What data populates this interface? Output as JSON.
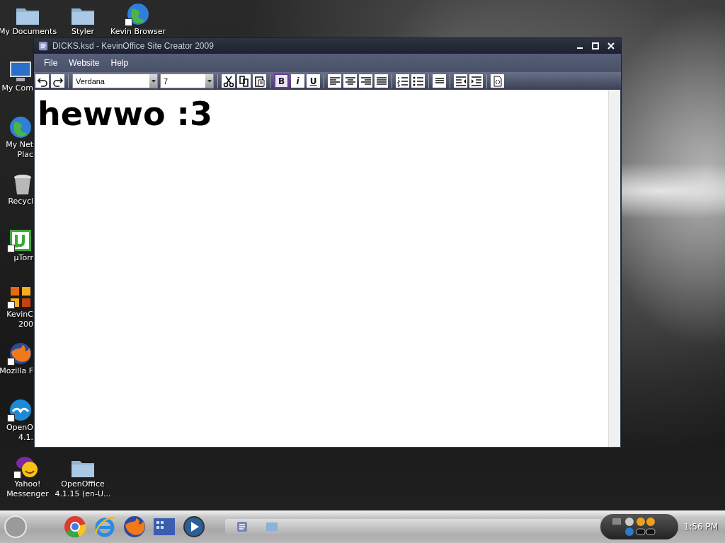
{
  "desktop_icons": [
    {
      "kind": "folder",
      "label_lines": [
        "My Documents"
      ]
    },
    {
      "kind": "folder",
      "label_lines": [
        "Styler"
      ]
    },
    {
      "kind": "globe",
      "shortcut": true,
      "label_lines": [
        "Kevin Browser"
      ]
    },
    {
      "kind": "computer",
      "label_lines": [
        "My Com"
      ]
    },
    {
      "kind": "globe",
      "label_lines": [
        "My Net",
        "Plac"
      ]
    },
    {
      "kind": "trash",
      "label_lines": [
        "Recycl"
      ]
    },
    {
      "kind": "torrent",
      "shortcut": true,
      "label_lines": [
        "µTorr"
      ]
    },
    {
      "kind": "office",
      "shortcut": true,
      "label_lines": [
        "KevinC",
        "200"
      ]
    },
    {
      "kind": "fox",
      "shortcut": true,
      "label_lines": [
        "Mozilla F"
      ]
    },
    {
      "kind": "gull",
      "shortcut": true,
      "label_lines": [
        "OpenO",
        "4.1."
      ]
    },
    {
      "kind": "smiley",
      "shortcut": true,
      "label_lines": [
        "Yahoo!",
        "Messenger"
      ]
    },
    {
      "kind": "folder",
      "label_lines": [
        "OpenOffice",
        "4.1.15 (en-U..."
      ]
    }
  ],
  "window": {
    "title": "DICKS.ksd - KevinOffice Site Creator 2009",
    "menu": [
      "File",
      "Website",
      "Help"
    ],
    "toolbar": [
      {
        "kind": "undo"
      },
      {
        "kind": "redo"
      },
      {
        "kind": "separator"
      },
      {
        "kind": "font",
        "value": "Verdana"
      },
      {
        "kind": "size",
        "value": "7"
      },
      {
        "kind": "separator"
      },
      {
        "kind": "cut"
      },
      {
        "kind": "copy"
      },
      {
        "kind": "paste"
      },
      {
        "kind": "separator"
      },
      {
        "kind": "format",
        "label": "B",
        "on": true
      },
      {
        "kind": "format",
        "label": "i",
        "on": false
      },
      {
        "kind": "format",
        "label": "U",
        "on": false
      },
      {
        "kind": "separator"
      },
      {
        "kind": "align-left"
      },
      {
        "kind": "align-center"
      },
      {
        "kind": "align-right"
      },
      {
        "kind": "justify"
      },
      {
        "kind": "separator"
      },
      {
        "kind": "numbered-list"
      },
      {
        "kind": "bullet-list"
      },
      {
        "kind": "separator"
      },
      {
        "kind": "paragraph"
      },
      {
        "kind": "separator"
      },
      {
        "kind": "outdent"
      },
      {
        "kind": "indent"
      },
      {
        "kind": "separator"
      },
      {
        "kind": "source"
      }
    ],
    "document": {
      "text": "hewwo :3"
    }
  },
  "taskbar": {
    "quick_launch": [
      {
        "kind": "chrome"
      },
      {
        "kind": "ie"
      },
      {
        "kind": "fox"
      },
      {
        "kind": "grid"
      },
      {
        "kind": "player"
      }
    ],
    "clock": "1:56 PM"
  }
}
